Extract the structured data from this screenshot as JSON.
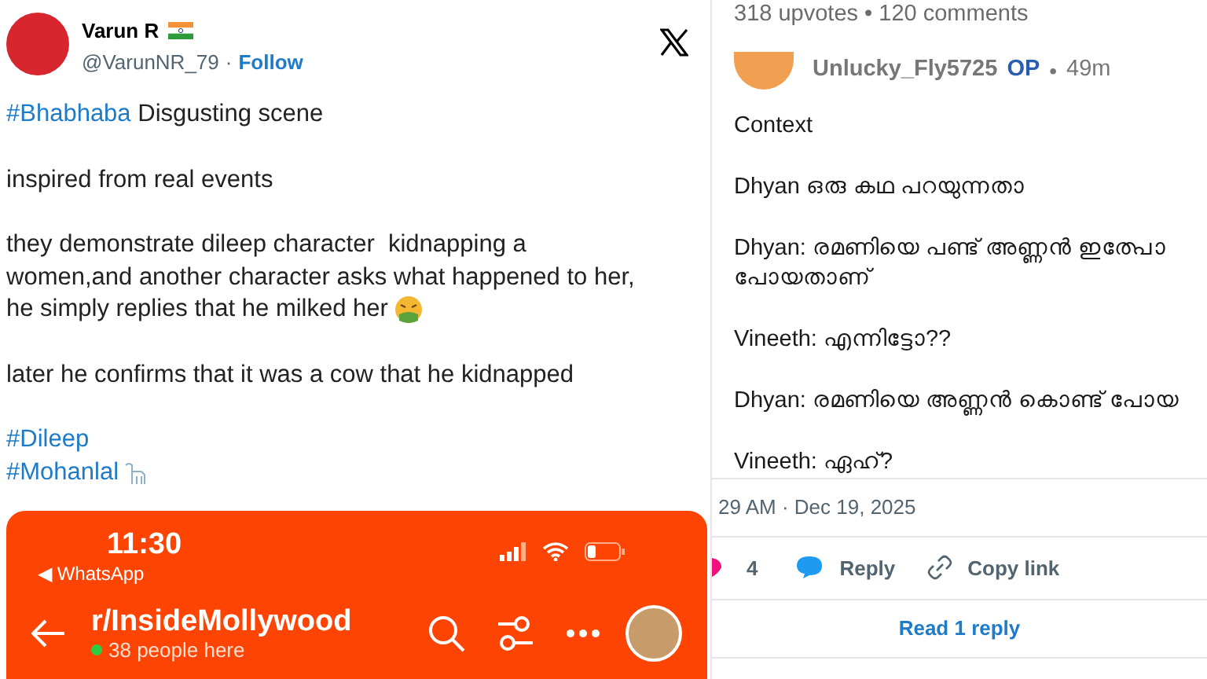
{
  "tweet": {
    "author": "Varun R",
    "handle": "@VarunNR_79",
    "separator": "·",
    "follow": "Follow",
    "paragraphs": [
      {
        "lines": [
          [
            {
              "kind": "hashtag",
              "text": "#Bhabhaba"
            },
            {
              "kind": "plain",
              "text": " Disgusting scene"
            }
          ]
        ]
      },
      {
        "lines": [
          [
            {
              "kind": "plain",
              "text": "inspired from real events"
            }
          ]
        ]
      },
      {
        "lines": [
          [
            {
              "kind": "plain",
              "text": "they demonstrate dileep character  kidnapping a"
            }
          ],
          [
            {
              "kind": "plain",
              "text": "women,and another character asks what happened to her,"
            }
          ],
          [
            {
              "kind": "plain",
              "text": "he simply replies that he milked her"
            },
            {
              "kind": "vomit"
            }
          ]
        ]
      },
      {
        "lines": [
          [
            {
              "kind": "plain",
              "text": "later he confirms that it was a cow that he kidnapped"
            }
          ]
        ]
      },
      {
        "lines": [
          [
            {
              "kind": "hashtag",
              "text": "#Dileep"
            }
          ],
          [
            {
              "kind": "hashtag",
              "text": "#Mohanlal"
            },
            {
              "kind": "cow"
            }
          ]
        ]
      }
    ]
  },
  "phone": {
    "time": "11:30",
    "back_app": "◀ WhatsApp",
    "subreddit": "r/InsideMollywood",
    "online": "38 people here"
  },
  "post_stats": "318 upvotes • 120 comments",
  "comment": {
    "user": "Unlucky_Fly5725",
    "badge": "OP",
    "separator": "•",
    "age": "49m",
    "paragraphs": [
      [
        "Context"
      ],
      [
        "Dhyan ഒരു കഥ പറയുന്നതാ"
      ],
      [
        "Dhyan: രമണിയെ പണ്ട് അണ്ണൻ ഇത്പോ",
        "പോയതാണ്"
      ],
      [
        "Vineeth: എന്നിട്ടോ??"
      ],
      [
        "Dhyan: രമണിയെ അണ്ണൻ കൊണ്ട് പോയ"
      ],
      [
        "Vineeth: ഏഹ്?"
      ]
    ]
  },
  "tweet_footer": {
    "timestamp": "29 AM · Dec 19, 2025",
    "likes": "4",
    "reply": "Reply",
    "copy_link": "Copy link",
    "read_replies": "Read 1 reply"
  }
}
